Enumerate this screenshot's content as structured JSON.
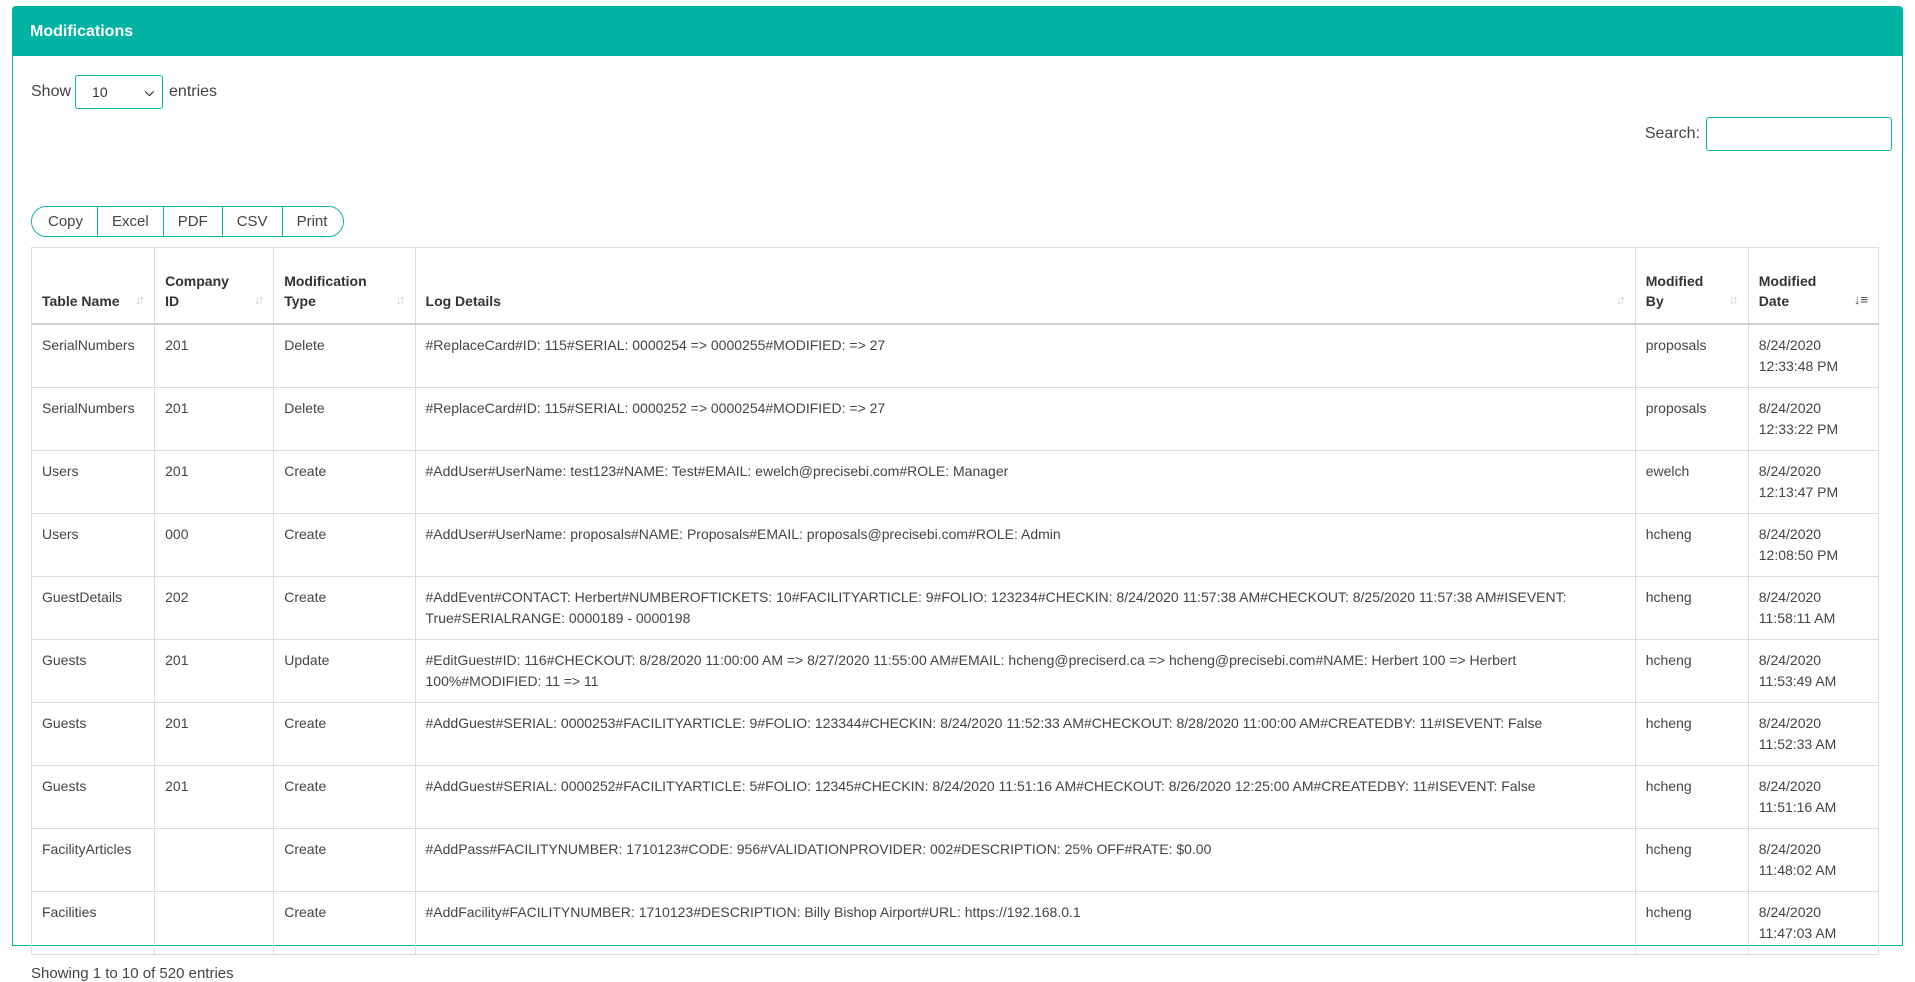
{
  "panel": {
    "title": "Modifications"
  },
  "length": {
    "prefix": "Show",
    "value": "10",
    "suffix": "entries"
  },
  "search": {
    "label": "Search:",
    "value": ""
  },
  "buttons": [
    "Copy",
    "Excel",
    "PDF",
    "CSV",
    "Print"
  ],
  "table": {
    "columns": [
      [
        "Table Name"
      ],
      [
        "Company",
        "ID"
      ],
      [
        "Modification",
        "Type"
      ],
      [
        "Log Details"
      ],
      [
        "Modified",
        "By"
      ],
      [
        "Modified",
        "Date"
      ]
    ],
    "rows": [
      [
        "SerialNumbers",
        "201",
        "Delete",
        "#ReplaceCard#ID: 115#SERIAL: 0000254 => 0000255#MODIFIED: => 27",
        "proposals",
        "8/24/2020",
        "12:33:48 PM"
      ],
      [
        "SerialNumbers",
        "201",
        "Delete",
        "#ReplaceCard#ID: 115#SERIAL: 0000252 => 0000254#MODIFIED: => 27",
        "proposals",
        "8/24/2020",
        "12:33:22 PM"
      ],
      [
        "Users",
        "201",
        "Create",
        "#AddUser#UserName: test123#NAME: Test#EMAIL: ewelch@precisebi.com#ROLE: Manager",
        "ewelch",
        "8/24/2020",
        "12:13:47 PM"
      ],
      [
        "Users",
        "000",
        "Create",
        "#AddUser#UserName: proposals#NAME: Proposals#EMAIL: proposals@precisebi.com#ROLE: Admin",
        "hcheng",
        "8/24/2020",
        "12:08:50 PM"
      ],
      [
        "GuestDetails",
        "202",
        "Create",
        "#AddEvent#CONTACT: Herbert#NUMBEROFTICKETS: 10#FACILITYARTICLE: 9#FOLIO: 123234#CHECKIN: 8/24/2020 11:57:38 AM#CHECKOUT: 8/25/2020 11:57:38 AM#ISEVENT: True#SERIALRANGE: 0000189 - 0000198",
        "hcheng",
        "8/24/2020",
        "11:58:11 AM"
      ],
      [
        "Guests",
        "201",
        "Update",
        "#EditGuest#ID: 116#CHECKOUT: 8/28/2020 11:00:00 AM => 8/27/2020 11:55:00 AM#EMAIL: hcheng@preciserd.ca => hcheng@precisebi.com#NAME: Herbert 100 => Herbert 100%#MODIFIED: 11 => 11",
        "hcheng",
        "8/24/2020",
        "11:53:49 AM"
      ],
      [
        "Guests",
        "201",
        "Create",
        "#AddGuest#SERIAL: 0000253#FACILITYARTICLE: 9#FOLIO: 123344#CHECKIN: 8/24/2020 11:52:33 AM#CHECKOUT: 8/28/2020 11:00:00 AM#CREATEDBY: 11#ISEVENT: False",
        "hcheng",
        "8/24/2020",
        "11:52:33 AM"
      ],
      [
        "Guests",
        "201",
        "Create",
        "#AddGuest#SERIAL: 0000252#FACILITYARTICLE: 5#FOLIO: 12345#CHECKIN: 8/24/2020 11:51:16 AM#CHECKOUT: 8/26/2020 12:25:00 AM#CREATEDBY: 11#ISEVENT: False",
        "hcheng",
        "8/24/2020",
        "11:51:16 AM"
      ],
      [
        "FacilityArticles",
        "",
        "Create",
        "#AddPass#FACILITYNUMBER: 1710123#CODE: 956#VALIDATIONPROVIDER: 002#DESCRIPTION: 25% OFF#RATE: $0.00",
        "hcheng",
        "8/24/2020",
        "11:48:02 AM"
      ],
      [
        "Facilities",
        "",
        "Create",
        "#AddFacility#FACILITYNUMBER: 1710123#DESCRIPTION: Billy Bishop Airport#URL: https://192.168.0.1",
        "hcheng",
        "8/24/2020",
        "11:47:03 AM"
      ]
    ]
  },
  "info": "Showing 1 to 10 of 520 entries",
  "colors": {
    "accent": "#02b3a4"
  }
}
